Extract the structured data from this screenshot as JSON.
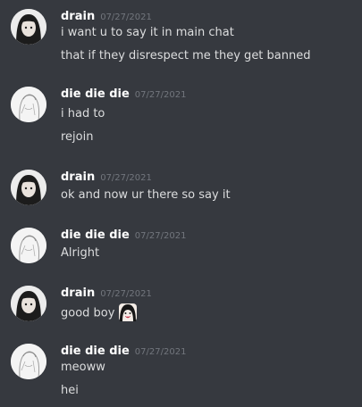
{
  "messages": [
    {
      "author": "drain",
      "timestamp": "07/27/2021",
      "lines": [
        "i want u to say it in main chat",
        "that if they disrespect me they get banned"
      ],
      "avatar": "dark-haired-girl-avatar"
    },
    {
      "author": "die die die",
      "timestamp": "07/27/2021",
      "lines": [
        "i had to",
        "rejoin"
      ],
      "avatar": "sketch-girl-avatar"
    },
    {
      "author": "drain",
      "timestamp": "07/27/2021",
      "lines": [
        "ok and now ur there so say it"
      ],
      "avatar": "dark-haired-girl-avatar"
    },
    {
      "author": "die die die",
      "timestamp": "07/27/2021",
      "lines": [
        "Alright"
      ],
      "avatar": "sketch-girl-avatar"
    },
    {
      "author": "drain",
      "timestamp": "07/27/2021",
      "lines": [
        "good boy"
      ],
      "emoji": "smiling-girl-emoji",
      "avatar": "dark-haired-girl-avatar"
    },
    {
      "author": "die die die",
      "timestamp": "07/27/2021",
      "lines": [
        "meoww",
        "hei"
      ],
      "avatar": "sketch-girl-avatar"
    }
  ],
  "colors": {
    "background": "#36393f",
    "username": "#ffffff",
    "timestamp": "#72767d",
    "text": "#dcddde"
  }
}
